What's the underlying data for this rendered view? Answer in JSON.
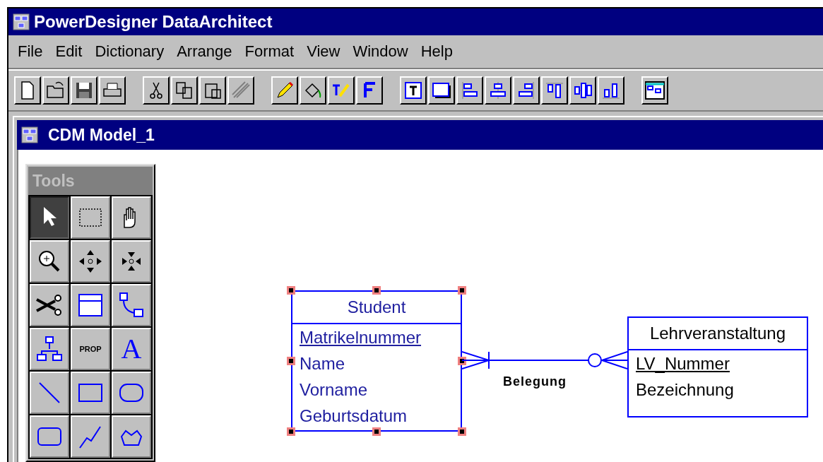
{
  "window": {
    "title": "PowerDesigner DataArchitect"
  },
  "menu": [
    {
      "label": "File"
    },
    {
      "label": "Edit"
    },
    {
      "label": "Dictionary"
    },
    {
      "label": "Arrange"
    },
    {
      "label": "Format"
    },
    {
      "label": "View"
    },
    {
      "label": "Window"
    },
    {
      "label": "Help"
    }
  ],
  "document": {
    "title": "CDM Model_1"
  },
  "tools_palette": {
    "title": "Tools",
    "tools": [
      {
        "kind": "pointer",
        "selected": true
      },
      {
        "kind": "lasso",
        "selected": false
      },
      {
        "kind": "hand",
        "selected": false
      },
      {
        "kind": "zoom",
        "selected": false
      },
      {
        "kind": "zoom-in",
        "selected": false
      },
      {
        "kind": "zoom-out",
        "selected": false
      },
      {
        "kind": "cut",
        "selected": false
      },
      {
        "kind": "entity",
        "selected": false
      },
      {
        "kind": "relationship",
        "selected": false
      },
      {
        "kind": "inheritance",
        "selected": false
      },
      {
        "kind": "prop",
        "label": "PROP",
        "selected": false
      },
      {
        "kind": "text",
        "label": "A",
        "selected": false
      },
      {
        "kind": "line",
        "selected": false
      },
      {
        "kind": "rectangle",
        "selected": false
      },
      {
        "kind": "ellipse",
        "selected": false
      },
      {
        "kind": "rounded-rectangle",
        "selected": false
      },
      {
        "kind": "polyline",
        "selected": false
      },
      {
        "kind": "polygon",
        "selected": false
      }
    ]
  },
  "entities": [
    {
      "name": "Student",
      "selected": true,
      "attributes": [
        {
          "name": "Matrikelnummer",
          "primary": true
        },
        {
          "name": "Name",
          "primary": false
        },
        {
          "name": "Vorname",
          "primary": false
        },
        {
          "name": "Geburtsdatum",
          "primary": false
        }
      ]
    },
    {
      "name": "Lehrveranstaltung",
      "selected": false,
      "attributes": [
        {
          "name": "LV_Nummer",
          "primary": true
        },
        {
          "name": "Bezeichnung",
          "primary": false
        }
      ]
    }
  ],
  "relationships": [
    {
      "name": "Belegung",
      "ends": [
        {
          "kind": "one_or_many"
        },
        {
          "kind": "zero_or_many"
        }
      ]
    }
  ]
}
